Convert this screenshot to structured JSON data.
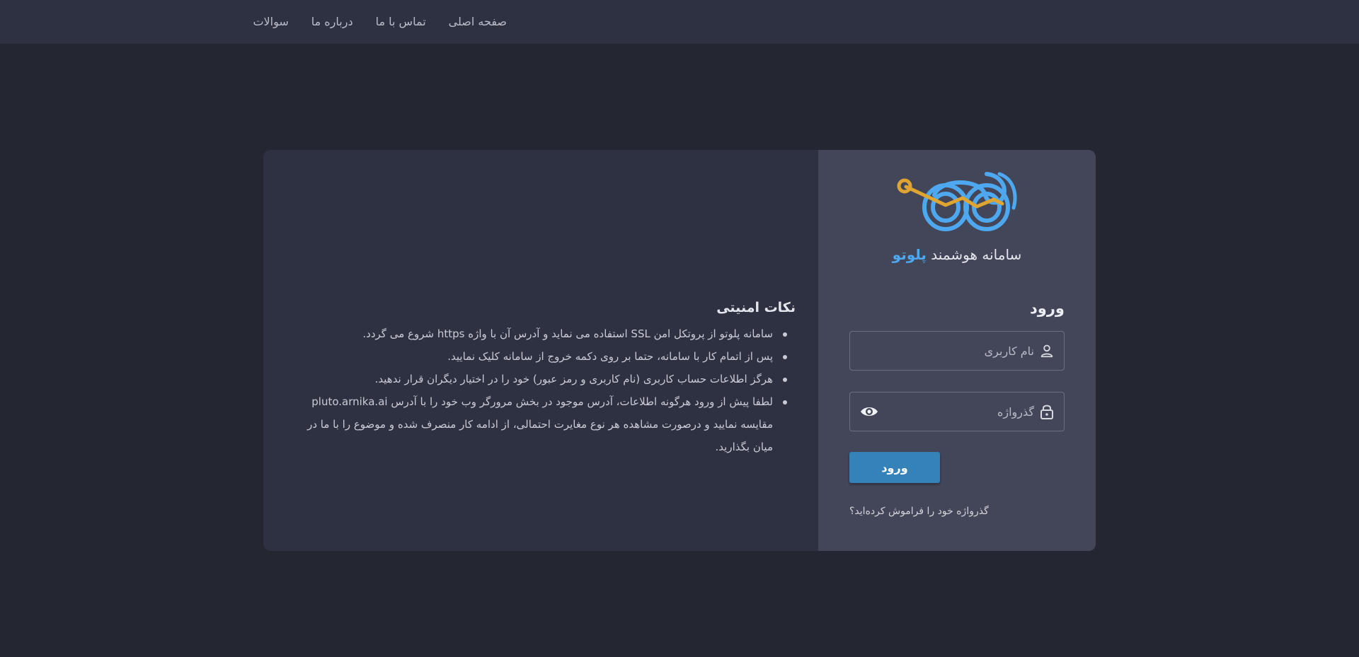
{
  "nav": {
    "items": [
      "صفحه اصلی",
      "تماس با ما",
      "درباره ما",
      "سوالات"
    ]
  },
  "brand": {
    "prefix": "سامانه هوشمند",
    "name": "پلوتو"
  },
  "tips": {
    "title": "نکات امنیتی",
    "items": [
      "سامانه پلوتو از پروتکل امن SSL استفاده می نماید و آدرس آن با واژه https شروع می گردد.",
      "پس از اتمام کار با سامانه، حتما بر روی دکمه خروج از سامانه کلیک نمایید.",
      "هرگز اطلاعات حساب کاربری (نام کاربری و رمز عبور) خود را در اختیار دیگران قرار ندهید.",
      "لطفا پیش از ورود هرگونه اطلاعات، آدرس موجود در بخش مرورگر وب خود را با آدرس pluto.arnika.ai مقایسه نمایید و درصورت مشاهده هر نوع مغایرت احتمالی، از ادامه کار منصرف شده و موضوع را با ما در میان بگذارید."
    ]
  },
  "login": {
    "title": "ورود",
    "username_placeholder": "نام کاربری",
    "password_placeholder": "گذرواژه",
    "submit_label": "ورود",
    "forgot_label": "گذرواژه خود را فراموش کرده‌اید؟"
  },
  "icons": {
    "user": "user-icon",
    "lock": "lock-icon",
    "eye": "eye-icon",
    "logo": "pluto-logo"
  },
  "colors": {
    "accent_blue": "#4ea8f0",
    "logo_orange": "#e0a530",
    "button_blue": "#3482b8",
    "nav_separator": "#c8952e"
  }
}
